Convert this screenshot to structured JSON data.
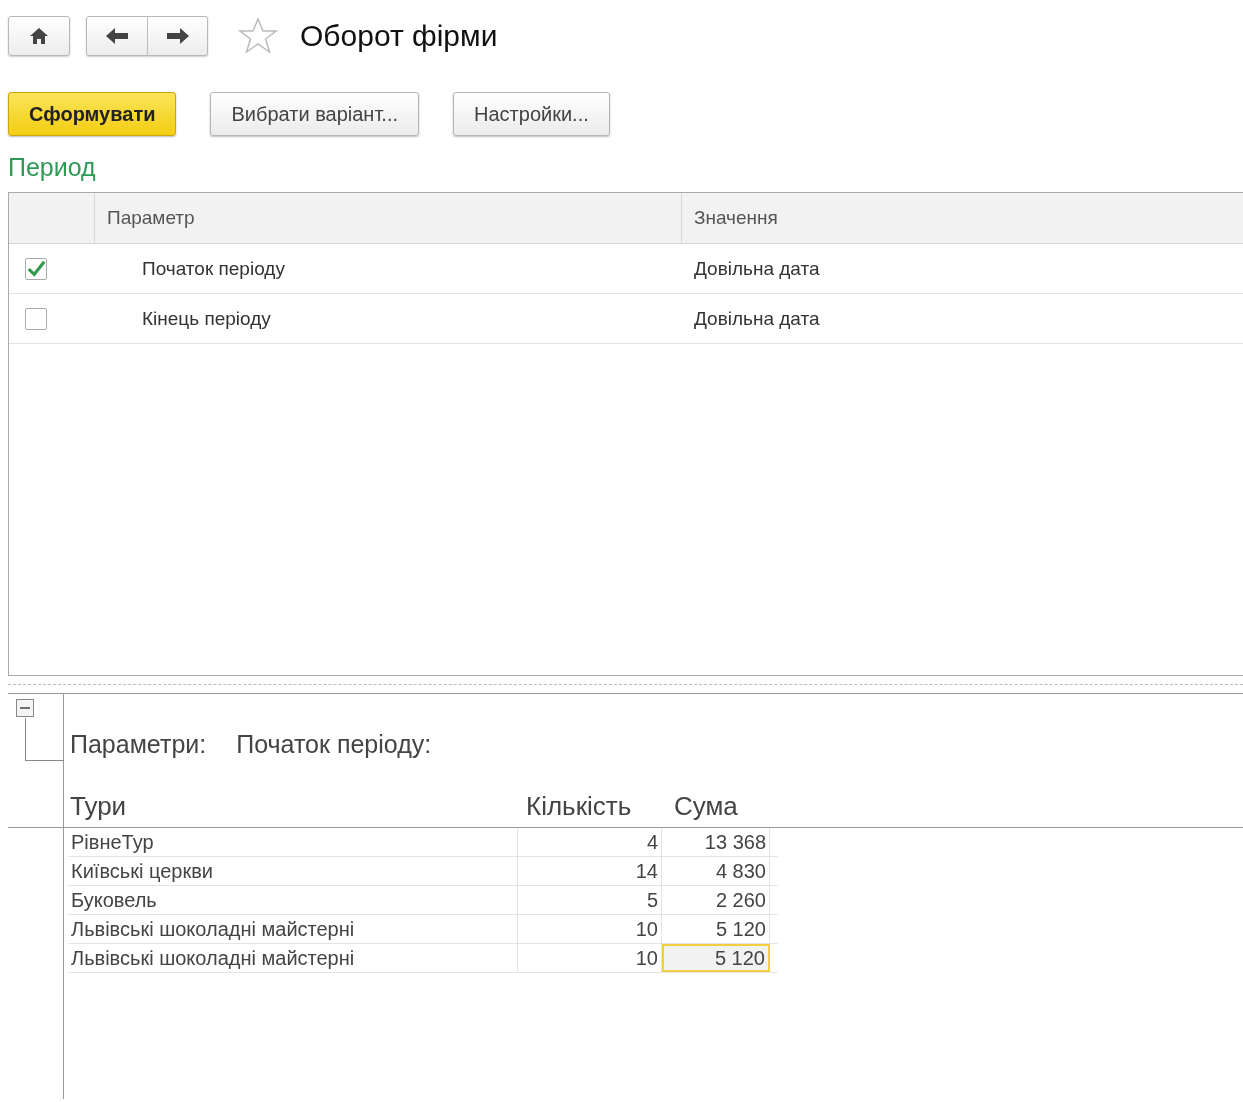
{
  "window": {
    "title": "Оборот фірми",
    "favorite": false
  },
  "buttons": [
    {
      "label": "Сформувати",
      "kind": "primary"
    },
    {
      "label": "Вибрати варіант...",
      "kind": "normal"
    },
    {
      "label": "Настройки...",
      "kind": "normal"
    }
  ],
  "period": {
    "title": "Период",
    "columns": [
      "Параметр",
      "Значення"
    ],
    "rows": [
      {
        "name": "Початок періоду",
        "value": "Довільна дата",
        "checked": true
      },
      {
        "name": "Кінець періоду",
        "value": "Довільна дата",
        "checked": false
      }
    ]
  },
  "report": {
    "group_expanded": true,
    "parameters_label": "Параметри:",
    "parameters_value": "Початок періоду:",
    "columns": [
      "Тури",
      "Кількість",
      "Сума"
    ],
    "rows": [
      {
        "tour": "РівнеТур",
        "count": "4",
        "sum": "13 368",
        "selected": false
      },
      {
        "tour": "Київські церкви",
        "count": "14",
        "sum": "4 830",
        "selected": false
      },
      {
        "tour": "Буковель",
        "count": "5",
        "sum": "2 260",
        "selected": false
      },
      {
        "tour": "Львівські шоколадні майстерні",
        "count": "10",
        "sum": "5 120",
        "selected": false
      },
      {
        "tour": "Львівські шоколадні майстерні",
        "count": "10",
        "sum": "5 120",
        "selected": true
      }
    ]
  }
}
